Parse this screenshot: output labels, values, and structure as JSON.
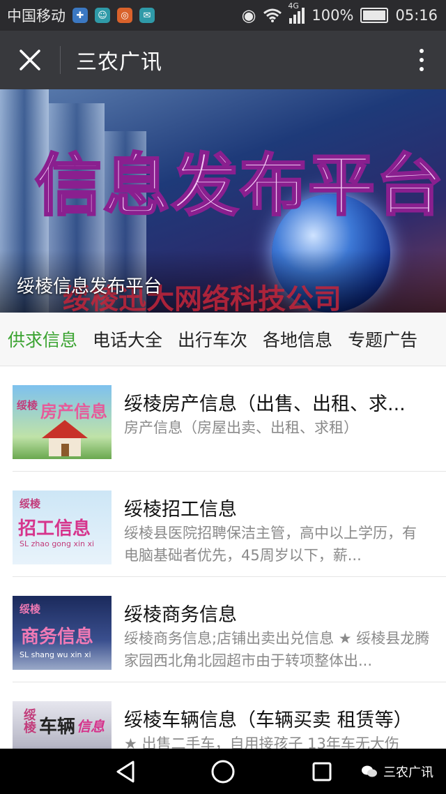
{
  "status_bar": {
    "carrier": "中国移动",
    "network": "4G",
    "battery": "100%",
    "time": "05:16",
    "icons": [
      "app-notification-icon",
      "app-notification-icon",
      "app-notification-icon",
      "mail-icon",
      "eye-icon",
      "wifi-icon",
      "signal-icon",
      "battery-icon"
    ]
  },
  "title_bar": {
    "title": "三农广讯"
  },
  "banner": {
    "headline": "信息发布平台",
    "company": "绥棱迅大网络科技公司",
    "caption": "绥棱信息发布平台"
  },
  "tabs": [
    {
      "label": "供求信息",
      "active": true
    },
    {
      "label": "电话大全",
      "active": false
    },
    {
      "label": "出行车次",
      "active": false
    },
    {
      "label": "各地信息",
      "active": false
    },
    {
      "label": "专题广告",
      "active": false
    }
  ],
  "articles": [
    {
      "title": "绥棱房产信息（出售、出租、求...",
      "desc": "房产信息（房屋出卖、出租、求租）",
      "thumb": {
        "line1": "绥棱",
        "line2": "房产信息"
      }
    },
    {
      "title": "绥棱招工信息",
      "desc": "绥棱县医院招聘保洁主管，高中以上学历，有电脑基础者优先，45周岁以下，薪...",
      "thumb": {
        "line1": "绥棱",
        "line2": "招工信息",
        "line3": "SL zhao gong xin xi"
      }
    },
    {
      "title": "绥棱商务信息",
      "desc": "绥棱商务信息;店铺出卖出兑信息 ★ 绥棱县龙腾家园西北角北园超市由于转项整体出...",
      "thumb": {
        "line1": "绥棱",
        "line2": "商务信息",
        "line3": "SL shang wu xin xi"
      }
    },
    {
      "title": "绥棱车辆信息（车辆买卖 租赁等）",
      "desc": "★ 出售二手车，自用接孩子 13年车无大伤",
      "thumb": {
        "line1": "绥棱",
        "line2": "车辆",
        "line3": "信息"
      }
    }
  ],
  "watermark": {
    "text": "三农广讯"
  },
  "colors": {
    "accent": "#3aa330",
    "title_bar": "#38393d",
    "status_bar": "#2b2b2e"
  }
}
